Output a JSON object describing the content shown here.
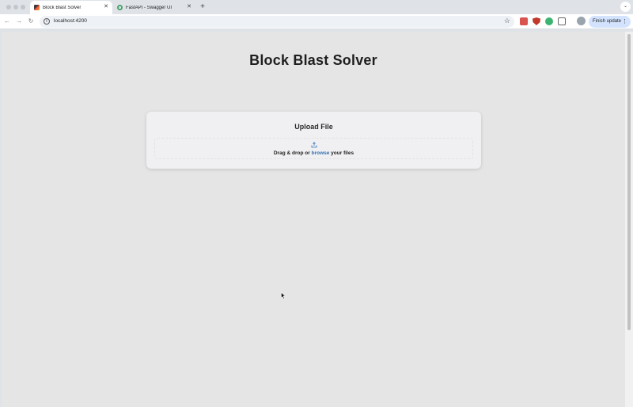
{
  "browser": {
    "tabs": [
      {
        "title": "Block Blast Solver",
        "active": true,
        "favicon": "block-blast-favicon"
      },
      {
        "title": "FastAPI - Swagger UI",
        "active": false,
        "favicon": "swagger-favicon"
      }
    ],
    "new_tab_glyph": "+",
    "tab_close_glyph": "✕",
    "address": "localhost:4200",
    "update_button": "Finish update",
    "icons": {
      "back": "←",
      "forward": "→",
      "reload": "↻",
      "info": "i",
      "star": "☆",
      "menu": "⋮",
      "chevron": "⌄"
    }
  },
  "page": {
    "title": "Block Blast Solver",
    "upload": {
      "heading": "Upload File",
      "prompt_before": "Drag & drop or",
      "browse_link": "browse",
      "prompt_after": "your files"
    }
  },
  "colors": {
    "page_background": "#e5e5e5",
    "card_background": "#f0f0f2",
    "link": "#2f6fb3",
    "update_pill": "#d3e3fd"
  }
}
